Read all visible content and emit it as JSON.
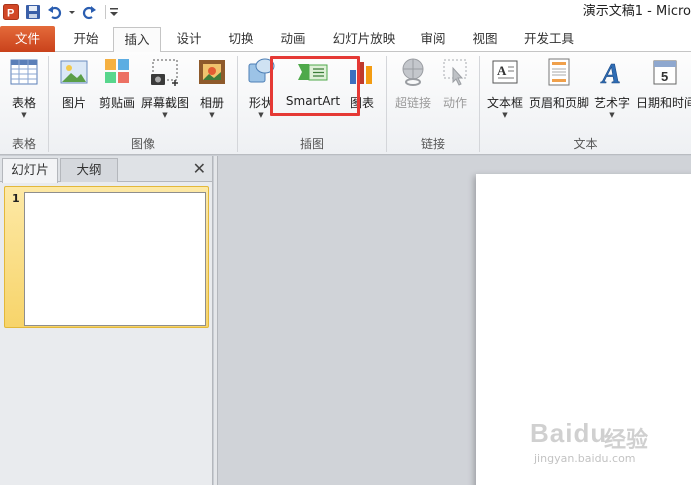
{
  "window": {
    "title": "演示文稿1 - Micro"
  },
  "tabs": [
    "文件",
    "开始",
    "插入",
    "设计",
    "切换",
    "动画",
    "幻灯片放映",
    "审阅",
    "视图",
    "开发工具"
  ],
  "ribbon": {
    "groups": {
      "table": {
        "label": "表格",
        "buttons": {
          "table": "表格"
        }
      },
      "images": {
        "label": "图像",
        "buttons": {
          "picture": "图片",
          "clipart": "剪贴画",
          "screenshot": "屏幕截图",
          "album": "相册"
        }
      },
      "illustrations": {
        "label": "插图",
        "buttons": {
          "shapes": "形状",
          "smartart": "SmartArt",
          "chart": "图表"
        }
      },
      "links": {
        "label": "链接",
        "buttons": {
          "hyperlink": "超链接",
          "action": "动作"
        }
      },
      "text": {
        "label": "文本",
        "buttons": {
          "textbox": "文本框",
          "headerfooter": "页眉和页脚",
          "wordart": "艺术字",
          "datetime": "日期和时间"
        }
      }
    }
  },
  "left_pane": {
    "tabs": [
      "幻灯片",
      "大纲"
    ],
    "close_glyph": "✕",
    "slide_number": "1"
  },
  "watermark": {
    "brand": "Baidu",
    "suffix": "经验",
    "url": "jingyan.baidu.com"
  },
  "colors": {
    "file_tab": "#d8542a",
    "highlight": "#e53935",
    "selected_slide": "#f7d46a"
  }
}
